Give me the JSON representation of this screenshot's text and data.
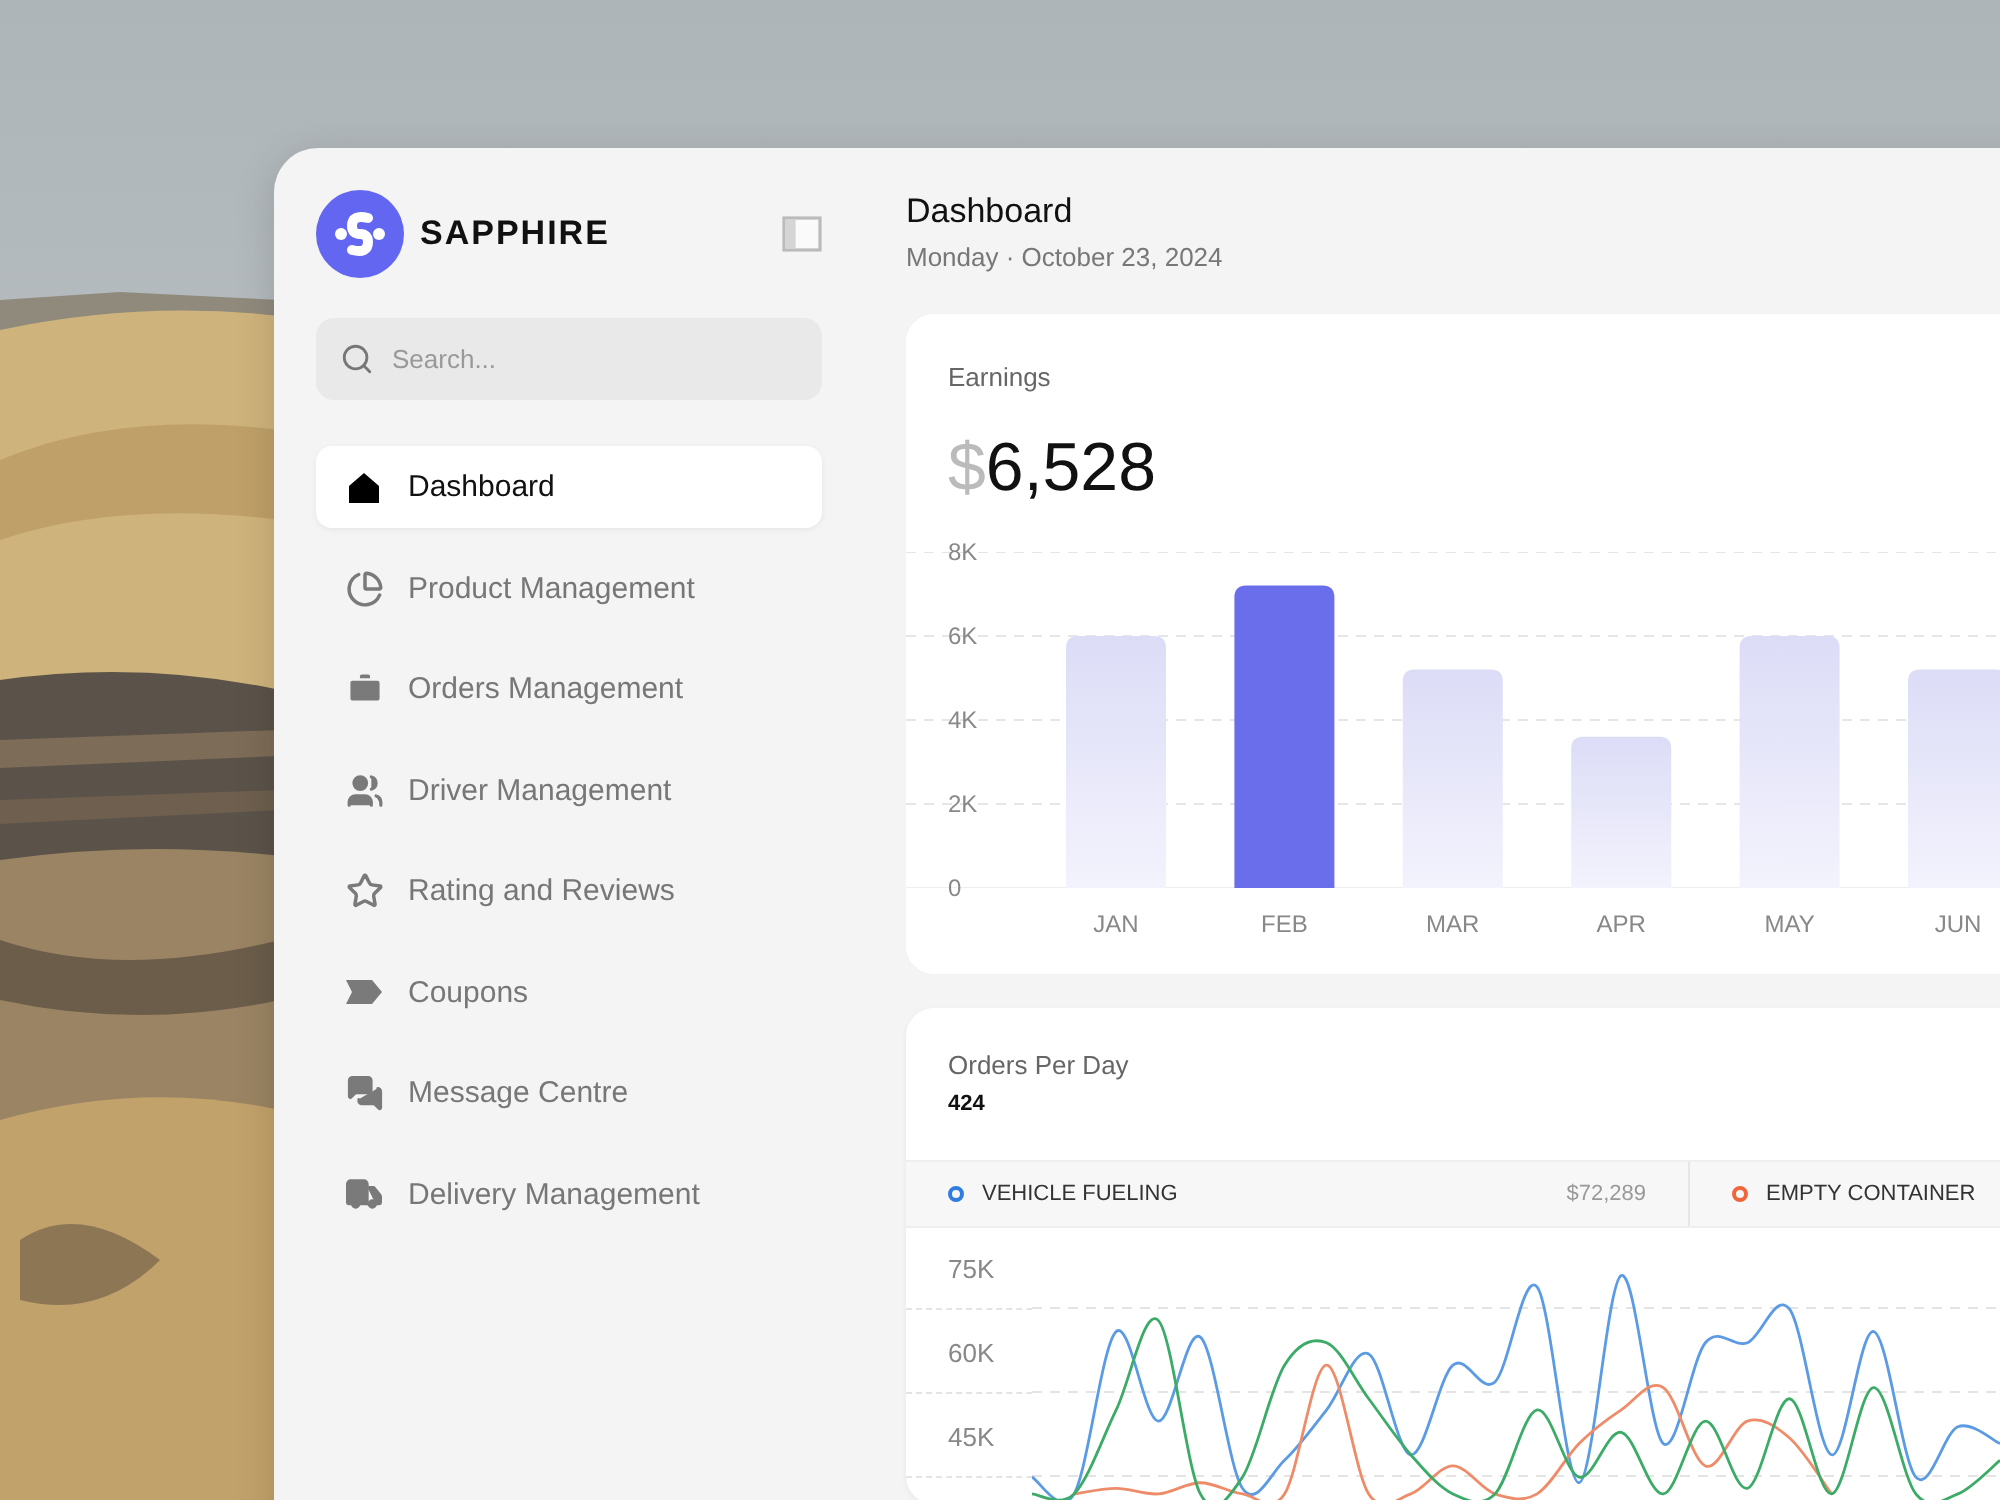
{
  "sidebar": {
    "brand": "SAPPHIRE",
    "search": {
      "placeholder": "Search..."
    },
    "items": [
      {
        "label": "Dashboard",
        "selected": true
      },
      {
        "label": "Product Management",
        "selected": false
      },
      {
        "label": "Orders Management",
        "selected": false
      },
      {
        "label": "Driver Management",
        "selected": false
      },
      {
        "label": "Rating and Reviews",
        "selected": false
      },
      {
        "label": "Coupons",
        "selected": false
      },
      {
        "label": "Message Centre",
        "selected": false
      },
      {
        "label": "Delivery Management",
        "selected": false
      }
    ]
  },
  "header": {
    "title": "Dashboard",
    "subtitle": "Monday · October 23, 2024"
  },
  "earnings": {
    "label": "Earnings",
    "currency": "$",
    "amount": "6,528",
    "chart_data": {
      "type": "bar",
      "categories": [
        "JAN",
        "FEB",
        "MAR",
        "APR",
        "MAY",
        "JUN"
      ],
      "stacked": true,
      "grid": true,
      "ylim": [
        0,
        8000
      ],
      "series": [
        {
          "color": "#dcdcf7",
          "values": [
            6000,
            null,
            5200,
            3600,
            6000,
            5200
          ]
        },
        {
          "color": "#6a6eea",
          "values": [
            null,
            7200,
            null,
            null,
            null,
            null
          ]
        }
      ],
      "yticks": [
        {
          "value": 0,
          "label": "0"
        },
        {
          "value": 2000,
          "label": "2K"
        },
        {
          "value": 4000,
          "label": "4K"
        },
        {
          "value": 6000,
          "label": "6K"
        },
        {
          "value": 8000,
          "label": "8K"
        }
      ]
    }
  },
  "orders": {
    "label": "Orders Per Day",
    "value": "424",
    "legend": [
      {
        "name": "VEHICLE FUELING",
        "value": "$72,289",
        "color": "#2f7de1"
      },
      {
        "name": "EMPTY CONTAINER",
        "color": "#f0653a"
      }
    ],
    "chart_data": {
      "type": "line",
      "ylim": [
        33200,
        82500
      ],
      "yticks": [
        {
          "value": 75000,
          "label": "75K"
        },
        {
          "value": 60000,
          "label": "60K"
        },
        {
          "value": 45000,
          "label": "45K"
        }
      ],
      "series": [
        {
          "color": "#5b9be3",
          "values": [
            38000,
            35000,
            64000,
            48000,
            63000,
            36000,
            41000,
            50000,
            60000,
            42000,
            58000,
            55000,
            72000,
            37000,
            74000,
            44000,
            62000,
            62000,
            68000,
            42000,
            64000,
            38000,
            47000,
            44000
          ]
        },
        {
          "color": "#ee8c6a",
          "values": [
            null,
            35000,
            36000,
            35000,
            37000,
            35000,
            35000,
            58000,
            35000,
            35000,
            40000,
            35000,
            35000,
            44000,
            50000,
            54000,
            40000,
            48000,
            45000,
            35000,
            null,
            null,
            null,
            null
          ]
        },
        {
          "color": "#3dab68",
          "values": [
            35000,
            35000,
            50000,
            66000,
            35000,
            38000,
            58000,
            62000,
            52000,
            42000,
            35000,
            35000,
            50000,
            38000,
            46000,
            35000,
            48000,
            36000,
            52000,
            35000,
            54000,
            35000,
            35000,
            41000
          ]
        }
      ]
    }
  }
}
